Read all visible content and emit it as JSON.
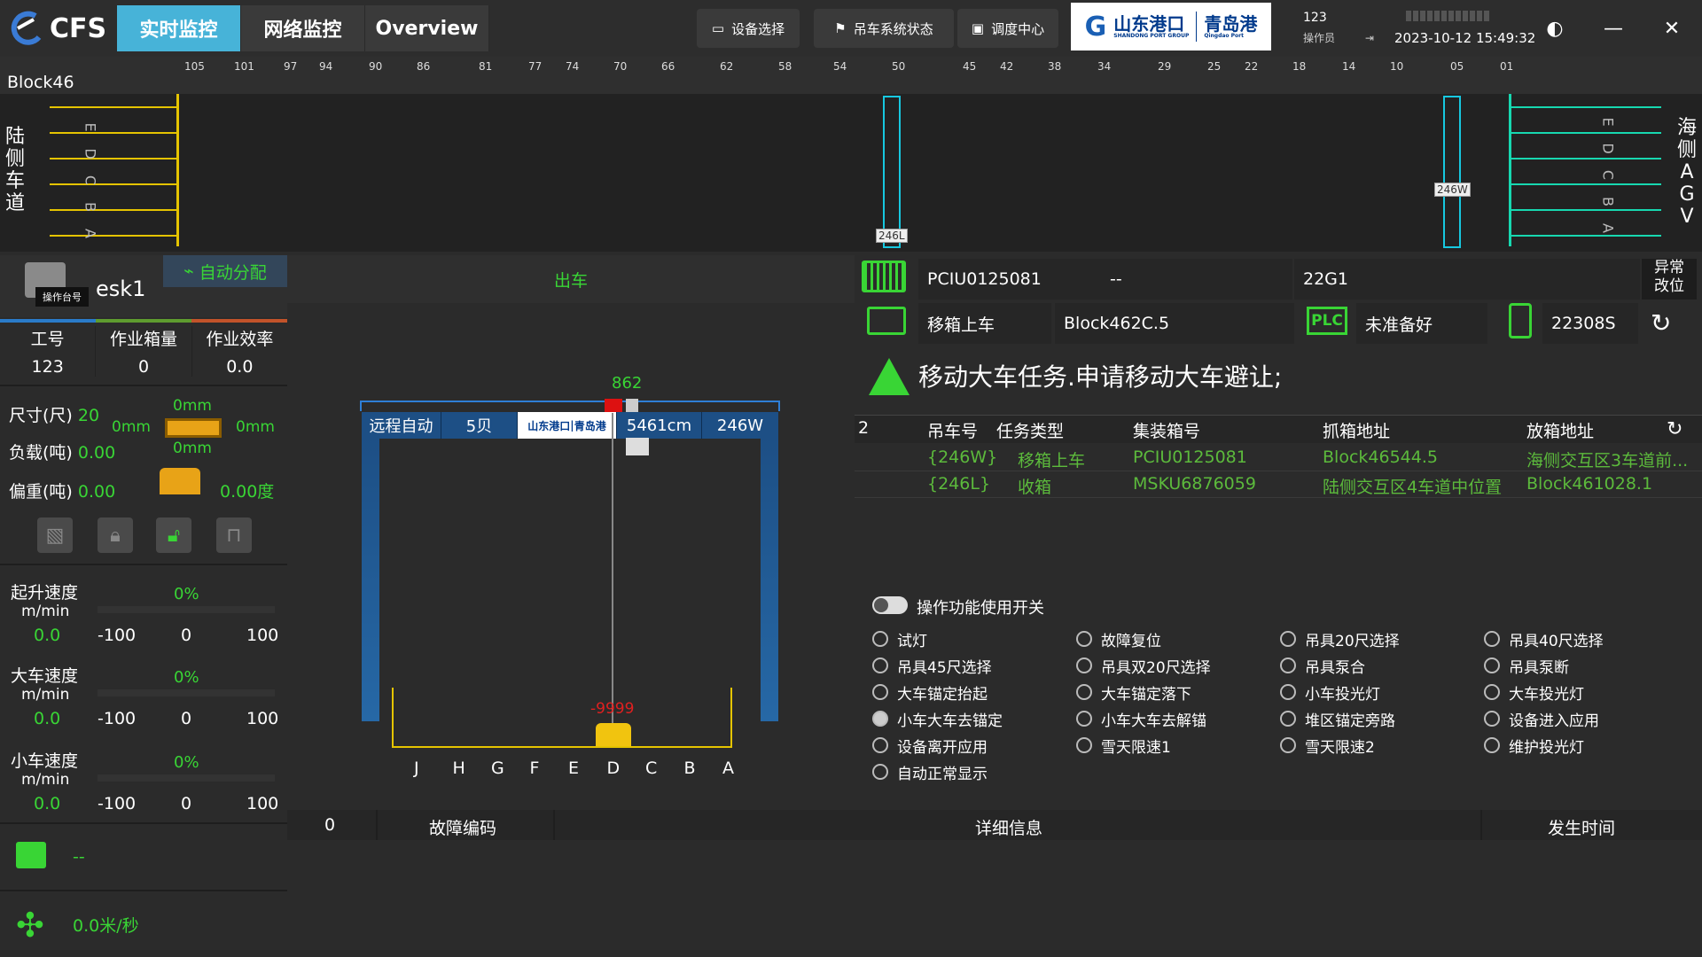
{
  "app": {
    "logo": "CFS",
    "brand_left": "山东港口",
    "brand_right": "青岛港",
    "brand_sub_left": "SHANDONG PORT GROUP",
    "brand_sub_right": "Qingdao Port"
  },
  "tabs": [
    {
      "label": "实时监控",
      "active": true
    },
    {
      "label": "网络监控",
      "active": false
    },
    {
      "label": "Overview",
      "active": false
    }
  ],
  "toolbar": {
    "device_select": "设备选择",
    "crane_status": "吊车系统状态",
    "dispatch": "调度中心"
  },
  "user": {
    "id": "123",
    "role": "操作员",
    "datetime": "2023-10-12 15:49:32"
  },
  "block": {
    "title": "Block46",
    "columns": [
      "105",
      "101",
      "97",
      "94",
      "90",
      "86",
      "81",
      "77",
      "74",
      "70",
      "66",
      "62",
      "58",
      "54",
      "50",
      "45",
      "42",
      "38",
      "34",
      "29",
      "25",
      "22",
      "18",
      "14",
      "10",
      "05",
      "01"
    ],
    "left_side": [
      "陆",
      "侧",
      "车",
      "道"
    ],
    "right_side": [
      "海",
      "侧",
      "A",
      "G",
      "V"
    ],
    "lanes": [
      "E",
      "D",
      "C",
      "B",
      "A"
    ],
    "crane1": "246L",
    "crane2": "246W"
  },
  "left": {
    "title_partial": "esk1",
    "tooltip": "操作台号",
    "auto": "自动分配",
    "stats": [
      {
        "label": "工号",
        "value": "123"
      },
      {
        "label": "作业箱量",
        "value": "0"
      },
      {
        "label": "作业效率",
        "value": "0.0"
      }
    ],
    "size_label": "尺寸(尺)",
    "size_value": "20",
    "load_label": "负载(吨)",
    "load_value": "0.00",
    "offset_label": "偏重(吨)",
    "offset_value": "0.00",
    "mm_top": "0mm",
    "mm_left": "0mm",
    "mm_right": "0mm",
    "mm_bottom": "0mm",
    "deg": "0.00度",
    "speeds": [
      {
        "label": "起升速度",
        "unit": "m/min",
        "pct": "0%",
        "value": "0.0"
      },
      {
        "label": "大车速度",
        "unit": "m/min",
        "pct": "0%",
        "value": "0.0"
      },
      {
        "label": "小车速度",
        "unit": "m/min",
        "pct": "0%",
        "value": "0.0"
      }
    ],
    "scale": [
      "-100",
      "0",
      "100"
    ],
    "msg": "--",
    "wind": "0.0米/秒"
  },
  "mid": {
    "title": "出车",
    "height": "862",
    "mode": "远程自动",
    "bay": "5贝",
    "pos": "5461cm",
    "crane": "246W",
    "trolley": "-9999",
    "bays": [
      "J",
      "H",
      "G",
      "F",
      "E",
      "D",
      "C",
      "B",
      "A"
    ]
  },
  "right": {
    "container": "PCIU0125081",
    "dash": "--",
    "iso": "22G1",
    "task": "移箱上车",
    "target": "Block462C.5",
    "plc": "PLC",
    "plc_state": "未准备好",
    "device": "22308S",
    "abnormal": "异常\n改位",
    "alert": "移动大车任务.申请移动大车避让;",
    "tasks_count": "2",
    "tasks_header": [
      "吊车号",
      "任务类型",
      "集装箱号",
      "抓箱地址",
      "放箱地址"
    ],
    "tasks": [
      [
        "{246W}",
        "移箱上车",
        "PCIU0125081",
        "Block46544.5",
        "海侧交互区3车道前..."
      ],
      [
        "{246L}",
        "收箱",
        "MSKU6876059",
        "陆侧交互区4车道中位置",
        "Block461028.1"
      ]
    ],
    "switch_label": "操作功能使用开关",
    "options": [
      [
        "试灯",
        "故障复位",
        "吊具20尺选择",
        "吊具40尺选择"
      ],
      [
        "吊具45尺选择",
        "吊具双20尺选择",
        "吊具泵合",
        "吊具泵断"
      ],
      [
        "大车锚定抬起",
        "大车锚定落下",
        "小车投光灯",
        "大车投光灯"
      ],
      [
        "小车大车去锚定",
        "小车大车去解锚",
        "堆区锚定旁路",
        "设备进入应用"
      ],
      [
        "设备离开应用",
        "雪天限速1",
        "雪天限速2",
        "维护投光灯"
      ],
      [
        "自动正常显示"
      ]
    ]
  },
  "fault": {
    "count": "0",
    "code": "故障编码",
    "detail": "详细信息",
    "time": "发生时间"
  }
}
